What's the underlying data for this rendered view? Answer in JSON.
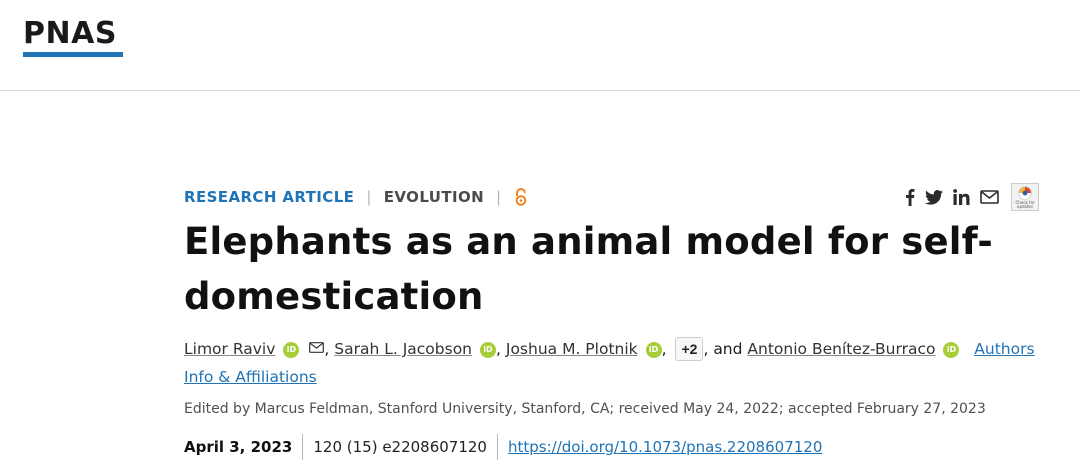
{
  "header": {
    "logo_text": "PNAS"
  },
  "article_meta": {
    "type": "RESEARCH ARTICLE",
    "separator": "|",
    "topic": "EVOLUTION",
    "open_access_icon": "open-access-icon"
  },
  "share": {
    "icons": [
      "facebook-icon",
      "twitter-icon",
      "linkedin-icon",
      "email-icon",
      "check-for-updates-icon"
    ],
    "updates_label": "Check for updates"
  },
  "title": "Elephants as an animal model for self-domestication",
  "authors": {
    "list": [
      {
        "name": "Limor Raviv",
        "orcid": "iD",
        "has_email": true
      },
      {
        "name": "Sarah L. Jacobson",
        "orcid": "iD"
      },
      {
        "name": "Joshua M. Plotnik",
        "orcid": "iD"
      },
      {
        "name": "Antonio Benítez-Burraco",
        "orcid": "iD"
      }
    ],
    "more_count": "+2",
    "conjunction": "and",
    "info_link": "Authors Info & Affiliations"
  },
  "edited_line": "Edited by Marcus Feldman, Stanford University, Stanford, CA; received May 24, 2022; accepted February 27, 2023",
  "pub": {
    "date": "April 3, 2023",
    "volume": "120 (15) e2208607120",
    "doi": "https://doi.org/10.1073/pnas.2208607120"
  },
  "colors": {
    "brand_blue": "#1f73b7",
    "orcid_green": "#a6ce39",
    "open_access_orange": "#f58220"
  }
}
